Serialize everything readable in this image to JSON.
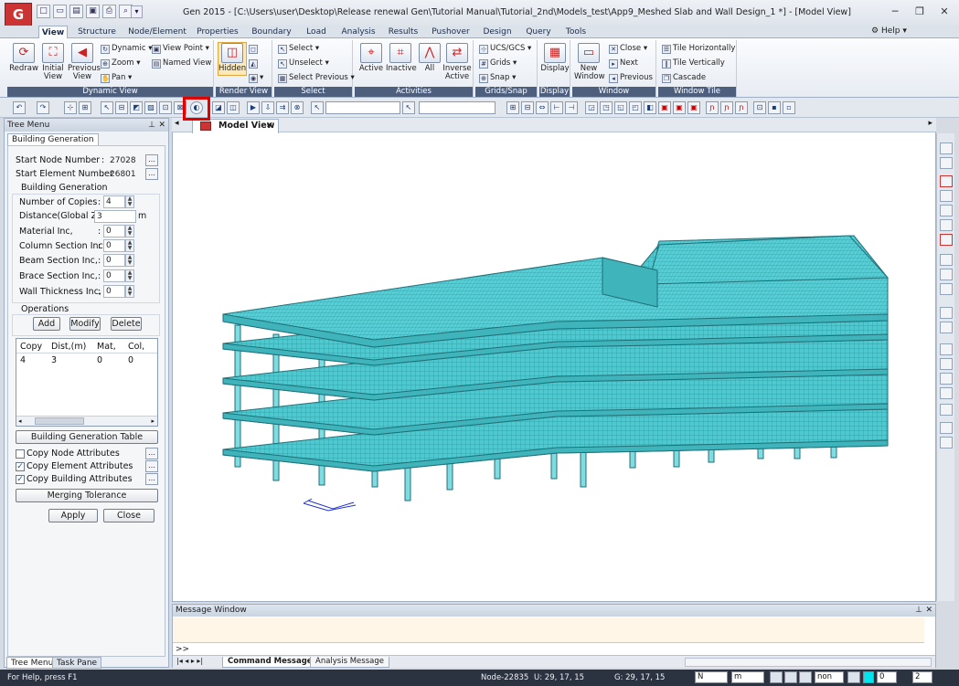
{
  "window": {
    "title": "Gen 2015 - [C:\\Users\\user\\Desktop\\Release renewal Gen\\Tutorial Manual\\Tutorial_2nd\\Models_test\\App9_Meshed Slab and Wall Design_1 *] - [Model View]",
    "app_icon_text": "G"
  },
  "menu": {
    "tabs": [
      "View",
      "Structure",
      "Node/Element",
      "Properties",
      "Boundary",
      "Load",
      "Analysis",
      "Results",
      "Pushover",
      "Design",
      "Query",
      "Tools"
    ],
    "help": "Help"
  },
  "ribbon": {
    "dynamic_view": {
      "label": "Dynamic View",
      "redraw": "Redraw",
      "initial_view": "Initial View",
      "previous_view": "Previous View",
      "dynamic": "Dynamic",
      "zoom": "Zoom",
      "pan": "Pan",
      "view_point": "View Point",
      "named_view": "Named View"
    },
    "render_view": {
      "label": "Render View",
      "hidden": "Hidden"
    },
    "select": {
      "label": "Select",
      "select": "Select",
      "unselect": "Unselect",
      "select_previous": "Select Previous"
    },
    "activities": {
      "label": "Activities",
      "active": "Active",
      "inactive": "Inactive",
      "all": "All",
      "inverse_active": "Inverse Active"
    },
    "grids_snap": {
      "label": "Grids/Snap",
      "ucs": "UCS/GCS",
      "grids": "Grids",
      "snap": "Snap"
    },
    "display": {
      "label": "Display",
      "display": "Display"
    },
    "window_group": {
      "label": "Window",
      "new_window": "New Window",
      "close": "Close",
      "next": "Next",
      "previous": "Previous"
    },
    "window_tile": {
      "label": "Window Tile",
      "tile_h": "Tile Horizontally",
      "tile_v": "Tile Vertically",
      "cascade": "Cascade"
    }
  },
  "tree": {
    "title": "Tree Menu",
    "tab": "Building Generation",
    "start_node_label": "Start Node Number",
    "start_node_value": "27028",
    "start_elem_label": "Start Element Number",
    "start_elem_value": "26801",
    "section_title": "Building Generation",
    "copies_label": "Number of Copies",
    "copies_value": "4",
    "distance_label": "Distance(Global Z):",
    "distance_value": "3",
    "distance_unit": "m",
    "material_label": "Material Inc,",
    "material_value": "0",
    "column_label": "Column Section Inc,",
    "column_value": "0",
    "beam_label": "Beam Section Inc,",
    "beam_value": "0",
    "brace_label": "Brace Section Inc,",
    "brace_value": "0",
    "wall_label": "Wall Thickness Inc,",
    "wall_value": "0",
    "operations_label": "Operations",
    "add": "Add",
    "modify": "Modify",
    "delete": "Delete",
    "grid_headers": [
      "Copy",
      "Dist,(m)",
      "Mat,",
      "Col,"
    ],
    "grid_rows": [
      [
        "4",
        "3",
        "0",
        "0"
      ]
    ],
    "gen_table": "Building Generation Table",
    "copy_node": "Copy Node Attributes",
    "copy_node_checked": false,
    "copy_element": "Copy Element Attributes",
    "copy_element_checked": true,
    "copy_building": "Copy Building Attributes",
    "copy_building_checked": true,
    "merging": "Merging Tolerance",
    "apply": "Apply",
    "close": "Close",
    "bottom_tabs": [
      "Tree Menu",
      "Task Pane"
    ]
  },
  "document": {
    "tab": "Model View"
  },
  "message": {
    "title": "Message Window",
    "prompt": ">>",
    "tabs": [
      "Command Message",
      "Analysis Message"
    ]
  },
  "status": {
    "help": "For Help, press F1",
    "node": "Node-22835",
    "u": "U: 29, 17, 15",
    "g": "G: 29, 17, 15",
    "unit_force": "N",
    "unit_length": "m",
    "snap_mode": "non",
    "num_a": "0",
    "num_b": "2"
  },
  "colors": {
    "structure_fill": "#4ec9cf",
    "structure_edge": "#1f6f78",
    "accent": "#e00000"
  }
}
